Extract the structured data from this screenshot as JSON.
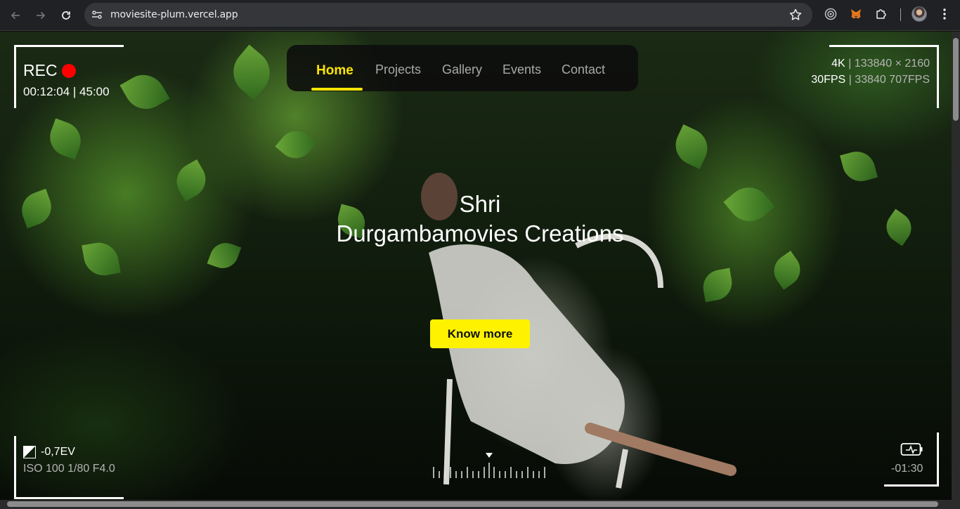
{
  "browser": {
    "url": "moviesite-plum.vercel.app",
    "icons": [
      "back-arrow-icon",
      "forward-arrow-icon",
      "reload-icon",
      "site-info-icon",
      "bookmark-star-icon",
      "extension-circle-icon",
      "metamask-fox-icon",
      "puzzle-extensions-icon",
      "profile-avatar",
      "more-vert-icon"
    ]
  },
  "hud": {
    "rec_label": "REC",
    "timecode": "00:12:04 | 45:00",
    "resolution_label": "4K",
    "resolution_detail": "| 133840 × 2160",
    "fps_label": "30FPS",
    "fps_detail": "| 33840 707FPS",
    "exposure": "-0,7EV",
    "iso_line": "ISO 100 1/80 F4.0",
    "time_remaining": "-01:30",
    "rec_color": "#ff0000"
  },
  "nav": {
    "items": [
      {
        "label": "Home",
        "active": true
      },
      {
        "label": "Projects",
        "active": false
      },
      {
        "label": "Gallery",
        "active": false
      },
      {
        "label": "Events",
        "active": false
      },
      {
        "label": "Contact",
        "active": false
      }
    ],
    "accent": "#ffe600"
  },
  "hero": {
    "title_line1": "Shri",
    "title_line2": "Durgambamovies Creations",
    "cta_label": "Know more",
    "cta_color": "#fff200"
  }
}
